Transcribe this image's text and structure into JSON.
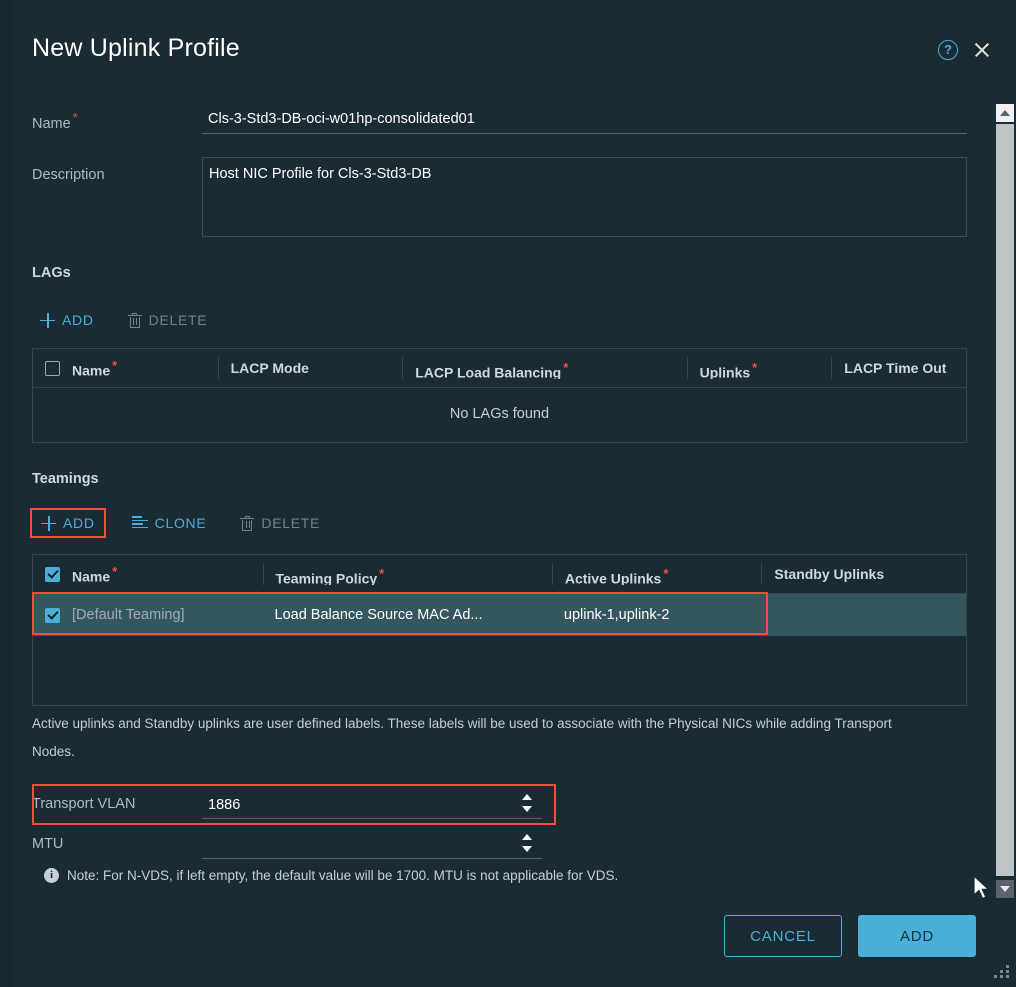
{
  "dialog": {
    "title": "New Uplink Profile",
    "help_icon": "help-circle-icon",
    "close_icon": "close-icon"
  },
  "form": {
    "name": {
      "label": "Name",
      "required": true,
      "value": "Cls-3-Std3-DB-oci-w01hp-consolidated01",
      "placeholder": ""
    },
    "description": {
      "label": "Description",
      "required": false,
      "value": "Host NIC Profile for Cls-3-Std3-DB",
      "placeholder": ""
    }
  },
  "lags": {
    "section_title": "LAGs",
    "toolbar": {
      "add_label": "ADD",
      "delete_label": "DELETE"
    },
    "columns": [
      "Name",
      "LACP Mode",
      "LACP Load Balancing",
      "Uplinks",
      "LACP Time Out"
    ],
    "required_columns": [
      true,
      false,
      true,
      true,
      false
    ],
    "empty_message": "No LAGs found",
    "rows": []
  },
  "teamings": {
    "section_title": "Teamings",
    "toolbar": {
      "add_label": "ADD",
      "clone_label": "CLONE",
      "delete_label": "DELETE"
    },
    "columns": [
      "Name",
      "Teaming Policy",
      "Active Uplinks",
      "Standby Uplinks"
    ],
    "required_columns": [
      true,
      true,
      true,
      false
    ],
    "rows": [
      {
        "selected": true,
        "name": "[Default Teaming]",
        "teaming_policy": "Load Balance Source MAC Ad...",
        "active_uplinks": "uplink-1,uplink-2",
        "standby_uplinks": ""
      }
    ],
    "help_text": "Active uplinks and Standby uplinks are user defined labels. These labels will be used to associate with the Physical NICs while adding Transport Nodes."
  },
  "transport_vlan": {
    "label": "Transport VLAN",
    "value": "1886"
  },
  "mtu": {
    "label": "MTU",
    "value": "",
    "note": "Note: For N-VDS, if left empty, the default value will be 1700. MTU is not applicable for VDS."
  },
  "footer": {
    "cancel_label": "CANCEL",
    "add_label": "ADD"
  },
  "colors": {
    "accent": "#49afd9",
    "highlight_outline": "#fd4b3c",
    "required_star": "#f54f47",
    "dialog_bg": "#1b2b34",
    "row_selected_bg": "#33565f"
  }
}
